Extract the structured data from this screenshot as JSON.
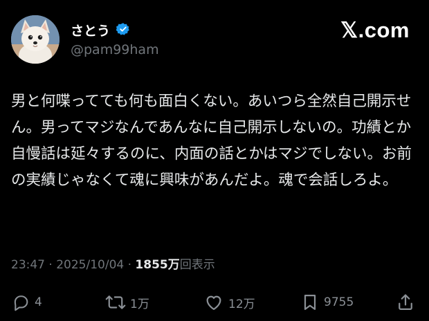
{
  "user": {
    "display_name": "さとう",
    "handle": "@pam99ham",
    "verified_badge_color": "#1d9bf0"
  },
  "brand": {
    "logo_text": "𝕏.com"
  },
  "tweet": {
    "text": "男と何喋ってても何も面白くない。あいつら全然自己開示せん。男ってマジなんであんなに自己開示しないの。功績とか自慢話は延々するのに、内面の話とかはマジでしない。お前の実績じゃなくて魂に興味があんだよ。魂で会話しろよ。"
  },
  "meta": {
    "time": "23:47",
    "separator": " · ",
    "date": "2025/10/04",
    "views_count": "1855万",
    "views_label": "回表示"
  },
  "actions": {
    "reply": {
      "icon": "reply-icon",
      "count": "4"
    },
    "repost": {
      "icon": "repost-icon",
      "count": "1万"
    },
    "like": {
      "icon": "like-icon",
      "count": "12万"
    },
    "bookmark": {
      "icon": "bookmark-icon",
      "count": "9755"
    },
    "share": {
      "icon": "share-icon"
    }
  },
  "colors": {
    "background": "#000000",
    "text_primary": "#e7e9ea",
    "text_secondary": "#71767b"
  }
}
